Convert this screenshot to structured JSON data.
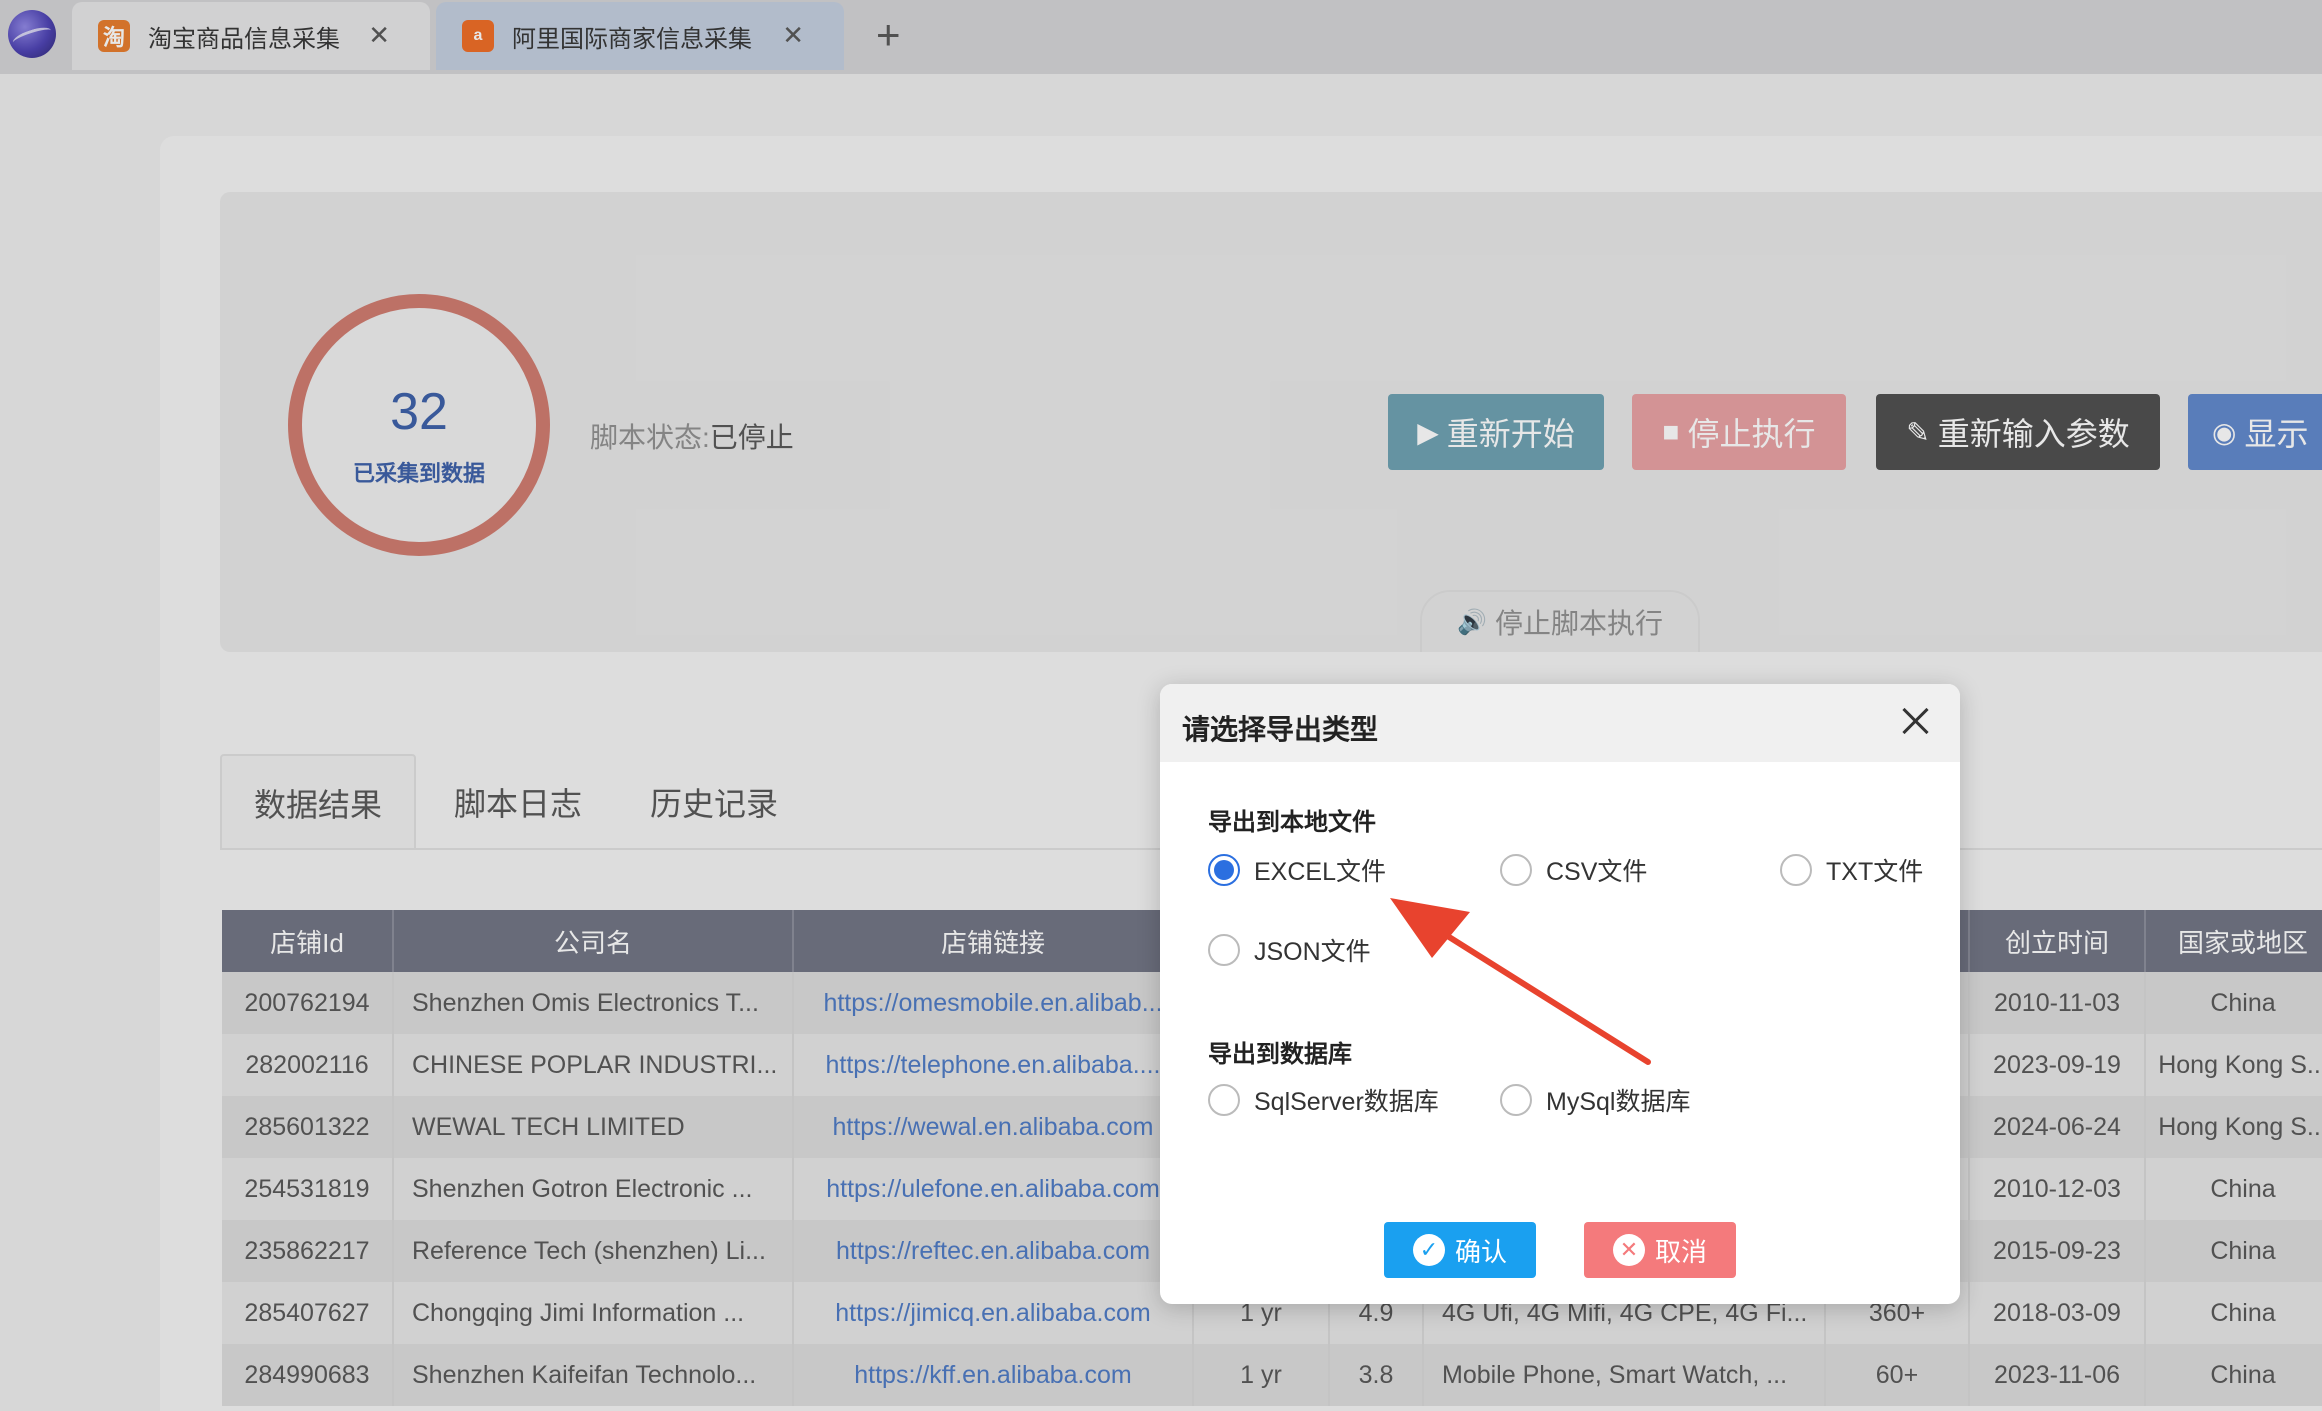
{
  "tabs": [
    {
      "label": "淘宝商品信息采集",
      "icon": "淘"
    },
    {
      "label": "阿里国际商家信息采集",
      "icon": "a"
    }
  ],
  "status": {
    "count": "32",
    "count_label": "已采集到数据",
    "script_status_label": "脚本状态:",
    "script_status_value": "已停止"
  },
  "buttons": {
    "restart": "重新开始",
    "stop": "停止执行",
    "reinput": "重新输入参数",
    "show": "显示"
  },
  "stop_script": "停止脚本执行",
  "result_tabs": [
    "数据结果",
    "脚本日志",
    "历史记录"
  ],
  "table": {
    "headers": [
      "店铺Id",
      "公司名",
      "店铺链接",
      "",
      "",
      "",
      "",
      "创立时间",
      "国家或地区"
    ],
    "rows": [
      [
        "200762194",
        "Shenzhen Omis Electronics T...",
        "https://omesmobile.en.alibab...",
        "",
        "",
        "",
        "",
        "2010-11-03",
        "China"
      ],
      [
        "282002116",
        "CHINESE POPLAR INDUSTRI...",
        "https://telephone.en.alibaba....",
        "",
        "",
        "",
        "",
        "2023-09-19",
        "Hong Kong S..."
      ],
      [
        "285601322",
        "WEWAL TECH LIMITED",
        "https://wewal.en.alibaba.com",
        "",
        "",
        "",
        "",
        "2024-06-24",
        "Hong Kong S..."
      ],
      [
        "254531819",
        "Shenzhen Gotron Electronic ...",
        "https://ulefone.en.alibaba.com",
        "",
        "",
        "",
        "",
        "2010-12-03",
        "China"
      ],
      [
        "235862217",
        "Reference Tech (shenzhen) Li...",
        "https://reftec.en.alibaba.com",
        "",
        "",
        "",
        "",
        "2015-09-23",
        "China"
      ],
      [
        "285407627",
        "Chongqing Jimi Information ...",
        "https://jimicq.en.alibaba.com",
        "1 yr",
        "4.9",
        "4G Ufi, 4G Mifi, 4G CPE, 4G Fi...",
        "360+",
        "2018-03-09",
        "China"
      ],
      [
        "284990683",
        "Shenzhen Kaifeifan Technolo...",
        "https://kff.en.alibaba.com",
        "1 yr",
        "3.8",
        "Mobile Phone, Smart Watch, ...",
        "60+",
        "2023-11-06",
        "China"
      ]
    ]
  },
  "dialog": {
    "title": "请选择导出类型",
    "section_local": "导出到本地文件",
    "section_db": "导出到数据库",
    "options_local": [
      "EXCEL文件",
      "CSV文件",
      "TXT文件",
      "JSON文件"
    ],
    "options_db": [
      "SqlServer数据库",
      "MySql数据库"
    ],
    "selected": "EXCEL文件",
    "confirm": "确认",
    "cancel": "取消"
  },
  "colors": {
    "accent": "#2b6fe0",
    "confirm": "#1aa0f0",
    "cancel": "#f47a7c",
    "arrow": "#e8432e"
  }
}
